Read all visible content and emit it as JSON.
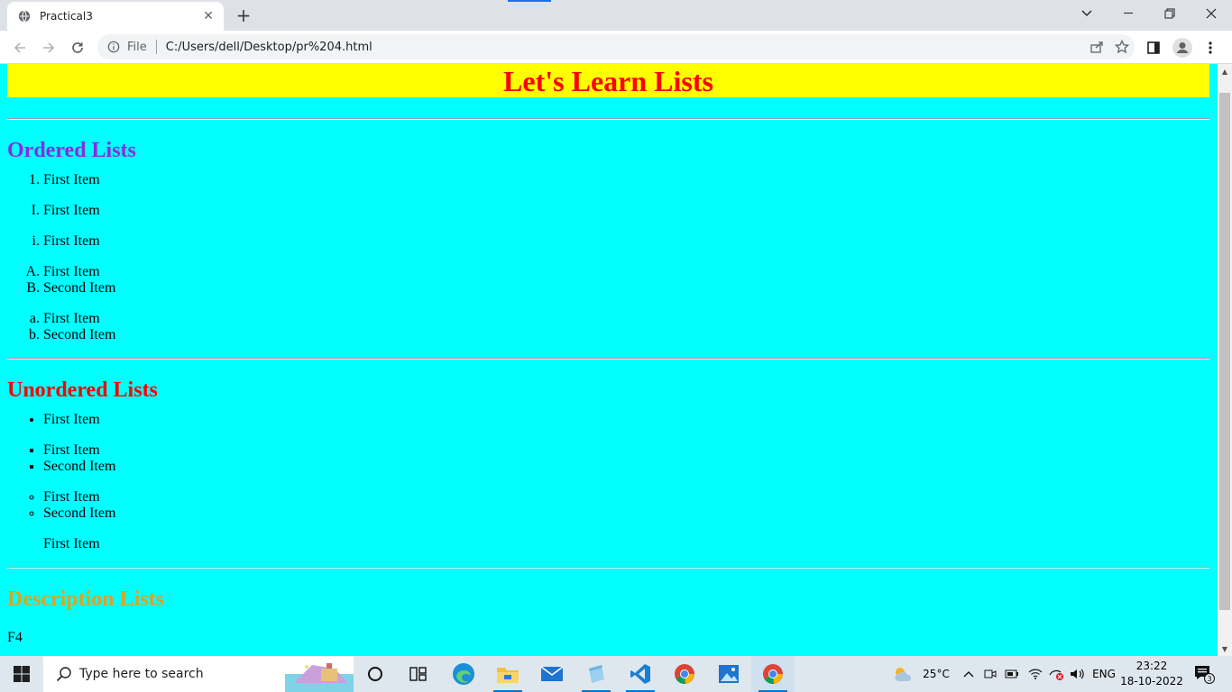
{
  "browser": {
    "tab_title": "Practical3",
    "new_tab_symbol": "+",
    "close_symbol": "✕",
    "scheme": "File",
    "url": "C:/Users/dell/Desktop/pr%204.html"
  },
  "page": {
    "title": "Let's Learn Lists",
    "title_color": "#ff0000",
    "title_bg": "#ffff00",
    "background": "#00ffff",
    "ordered": {
      "heading": "Ordered Lists",
      "heading_color": "#8a2be2",
      "lists": [
        {
          "type": "1",
          "items": [
            "First Item"
          ]
        },
        {
          "type": "I",
          "items": [
            "First Item"
          ]
        },
        {
          "type": "i",
          "items": [
            "First Item"
          ]
        },
        {
          "type": "A",
          "items": [
            "First Item",
            "Second Item"
          ]
        },
        {
          "type": "a",
          "items": [
            "First Item",
            "Second Item"
          ]
        }
      ]
    },
    "unordered": {
      "heading": "Unordered Lists",
      "heading_color": "#ff0000",
      "lists": [
        {
          "style": "disc",
          "items": [
            "First Item"
          ]
        },
        {
          "style": "square",
          "items": [
            "First Item",
            "Second Item"
          ]
        },
        {
          "style": "circle",
          "items": [
            "First Item",
            "Second Item"
          ]
        },
        {
          "style": "none",
          "items": [
            "First Item"
          ]
        }
      ]
    },
    "description": {
      "heading": "Description Lists",
      "heading_color": "#daa520",
      "first_term": "F4"
    }
  },
  "taskbar": {
    "search_placeholder": "Type here to search",
    "weather": "25°C",
    "language": "ENG",
    "time": "23:22",
    "date": "18-10-2022",
    "notification_count": "3",
    "apps": [
      "task-view-icon",
      "edge-icon",
      "file-explorer-icon",
      "mail-icon",
      "notepad-icon",
      "vscode-icon",
      "chrome-icon",
      "photos-icon",
      "chrome-active-icon"
    ]
  }
}
